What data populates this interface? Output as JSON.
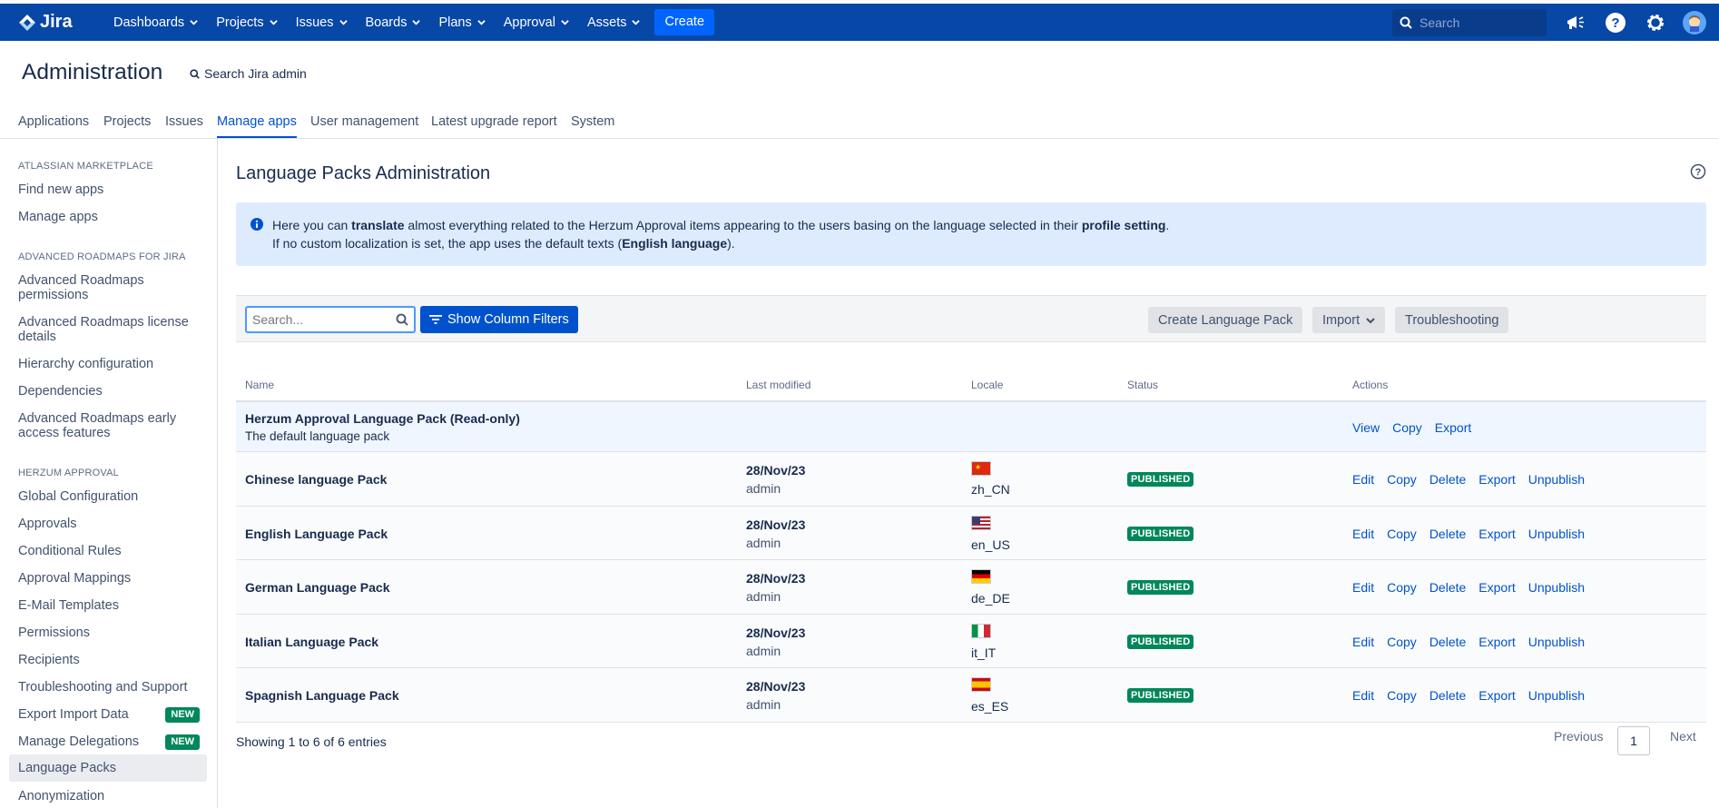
{
  "topnav": {
    "logo": "Jira",
    "items": [
      "Dashboards",
      "Projects",
      "Issues",
      "Boards",
      "Plans",
      "Approval",
      "Assets"
    ],
    "create": "Create",
    "search_placeholder": "Search"
  },
  "admin": {
    "title": "Administration",
    "search": "Search Jira admin",
    "tabs": [
      "Applications",
      "Projects",
      "Issues",
      "Manage apps",
      "User management",
      "Latest upgrade report",
      "System"
    ]
  },
  "sidebar": {
    "sections": [
      {
        "heading": "ATLASSIAN MARKETPLACE",
        "items": [
          "Find new apps",
          "Manage apps"
        ]
      },
      {
        "heading": "ADVANCED ROADMAPS FOR JIRA",
        "items": [
          "Advanced Roadmaps permissions",
          "Advanced Roadmaps license details",
          "Hierarchy configuration",
          "Dependencies",
          "Advanced Roadmaps early access features"
        ]
      },
      {
        "heading": "HERZUM APPROVAL",
        "items": [
          "Global Configuration",
          "Approvals",
          "Conditional Rules",
          "Approval Mappings",
          "E-Mail Templates",
          "Permissions",
          "Recipients",
          "Troubleshooting and Support",
          "Export Import Data",
          "Manage Delegations",
          "Language Packs",
          "Anonymization"
        ]
      }
    ],
    "new_badge": "NEW"
  },
  "main": {
    "title": "Language Packs Administration",
    "info": {
      "l1_a": "Here you can ",
      "l1_b": "translate",
      "l1_c": " almost everything related to the Herzum Approval items appearing to the users basing on the language selected in their ",
      "l1_d": "profile setting",
      "l1_e": ".",
      "l2_a": "If no custom localization is set, the app uses the default texts (",
      "l2_b": "English language",
      "l2_c": ")."
    },
    "toolbar": {
      "search_placeholder": "Search...",
      "filters": "Show Column Filters",
      "create": "Create Language Pack",
      "import": "Import",
      "troubleshooting": "Troubleshooting"
    },
    "columns": [
      "Name",
      "Last modified",
      "Locale",
      "Status",
      "Actions"
    ],
    "default_row": {
      "name": "Herzum Approval Language Pack (Read-only)",
      "desc": "The default language pack",
      "actions": [
        "View",
        "Copy",
        "Export"
      ]
    },
    "rows": [
      {
        "name": "Chinese language Pack",
        "date": "28/Nov/23",
        "by": "admin",
        "locale": "zh_CN",
        "status": "PUBLISHED"
      },
      {
        "name": "English Language Pack",
        "date": "28/Nov/23",
        "by": "admin",
        "locale": "en_US",
        "status": "PUBLISHED"
      },
      {
        "name": "German Language Pack",
        "date": "28/Nov/23",
        "by": "admin",
        "locale": "de_DE",
        "status": "PUBLISHED"
      },
      {
        "name": "Italian Language Pack",
        "date": "28/Nov/23",
        "by": "admin",
        "locale": "it_IT",
        "status": "PUBLISHED"
      },
      {
        "name": "Spagnish Language Pack",
        "date": "28/Nov/23",
        "by": "admin",
        "locale": "es_ES",
        "status": "PUBLISHED"
      }
    ],
    "row_actions": [
      "Edit",
      "Copy",
      "Delete",
      "Export",
      "Unpublish"
    ],
    "footer": "Showing 1 to 6 of 6 entries",
    "pager": {
      "prev": "Previous",
      "page": "1",
      "next": "Next"
    }
  }
}
